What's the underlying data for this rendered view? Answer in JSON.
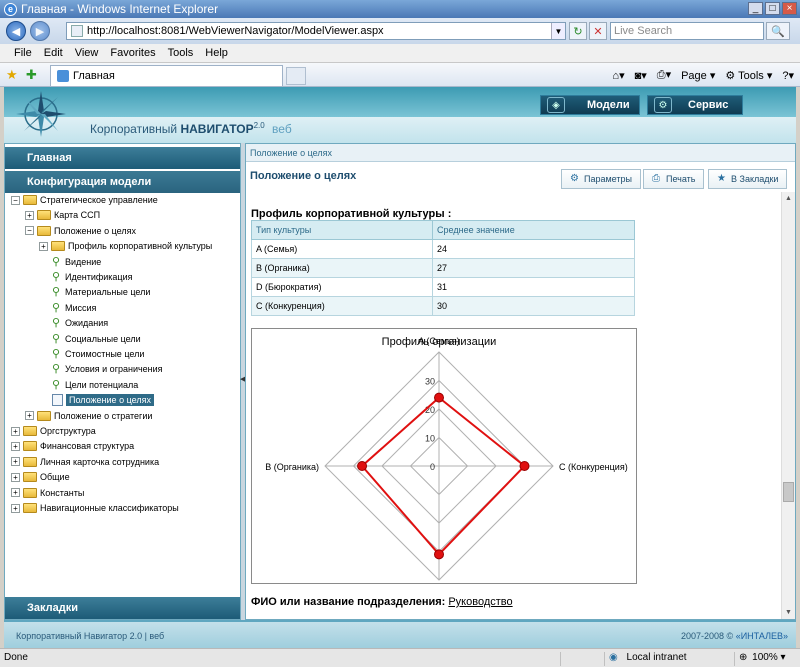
{
  "window": {
    "title": "Главная - Windows Internet Explorer"
  },
  "browser": {
    "address": "http://localhost:8081/WebViewerNavigator/ModelViewer.aspx",
    "search_placeholder": "Live Search",
    "menu": [
      "File",
      "Edit",
      "View",
      "Favorites",
      "Tools",
      "Help"
    ],
    "tab_title": "Главная",
    "commands": {
      "page": "Page",
      "tools": "Tools"
    }
  },
  "header": {
    "brand_name": "Корпоративный",
    "brand_bold": "НАВИГАТОР",
    "brand_version": "2.0",
    "brand_web": "веб",
    "buttons": [
      {
        "label": "Модели"
      },
      {
        "label": "Сервис"
      }
    ]
  },
  "left_panel": {
    "home": "Главная",
    "config": "Конфигурация модели",
    "bookmarks": "Закладки",
    "tree": [
      {
        "label": "Стратегическое управление",
        "level": 0,
        "type": "folder",
        "expander": "−"
      },
      {
        "label": "Карта ССП",
        "level": 1,
        "type": "folder",
        "expander": "+"
      },
      {
        "label": "Положение о целях",
        "level": 1,
        "type": "folder",
        "expander": "−"
      },
      {
        "label": "Профиль корпоративной культуры",
        "level": 2,
        "type": "folder",
        "expander": "+"
      },
      {
        "label": "Видение",
        "level": 2,
        "type": "leaf"
      },
      {
        "label": "Идентификация",
        "level": 2,
        "type": "leaf"
      },
      {
        "label": "Материальные цели",
        "level": 2,
        "type": "leaf"
      },
      {
        "label": "Миссия",
        "level": 2,
        "type": "leaf"
      },
      {
        "label": "Ожидания",
        "level": 2,
        "type": "leaf"
      },
      {
        "label": "Социальные цели",
        "level": 2,
        "type": "leaf"
      },
      {
        "label": "Стоимостные цели",
        "level": 2,
        "type": "leaf"
      },
      {
        "label": "Условия и ограничения",
        "level": 2,
        "type": "leaf"
      },
      {
        "label": "Цели потенциала",
        "level": 2,
        "type": "leaf"
      },
      {
        "label": "Положение о целях",
        "level": 2,
        "type": "page",
        "selected": true
      },
      {
        "label": "Положение о стратегии",
        "level": 1,
        "type": "folder",
        "expander": "+"
      },
      {
        "label": "Оргструктура",
        "level": 0,
        "type": "folder",
        "expander": "+"
      },
      {
        "label": "Финансовая структура",
        "level": 0,
        "type": "folder",
        "expander": "+"
      },
      {
        "label": "Личная карточка сотрудника",
        "level": 0,
        "type": "folder",
        "expander": "+"
      },
      {
        "label": "Общие",
        "level": 0,
        "type": "folder",
        "expander": "+"
      },
      {
        "label": "Константы",
        "level": 0,
        "type": "folder",
        "expander": "+"
      },
      {
        "label": "Навигационные классификаторы",
        "level": 0,
        "type": "folder",
        "expander": "+"
      }
    ]
  },
  "main": {
    "breadcrumb": "Положение о целях",
    "title": "Положение о целях",
    "toolbar": [
      {
        "label": "Параметры",
        "icon": "gear-icon"
      },
      {
        "label": "Печать",
        "icon": "printer-icon"
      },
      {
        "label": "В Закладки",
        "icon": "star-icon"
      }
    ],
    "section_title": "Профиль корпоративной культуры :",
    "table": {
      "headers": [
        "Тип культуры",
        "Среднее значение"
      ],
      "rows": [
        [
          "A (Семья)",
          "24"
        ],
        [
          "B (Органика)",
          "27"
        ],
        [
          "D (Бюрократия)",
          "31"
        ],
        [
          "C (Конкуренция)",
          "30"
        ]
      ]
    },
    "fio_label": "ФИО или название подразделения:",
    "fio_value": "Руководство"
  },
  "chart_data": {
    "type": "radar",
    "title": "Профиль организации",
    "categories": [
      "A (Семья)",
      "C (Конкуренция)",
      "D (Бюрократия)",
      "B (Органика)"
    ],
    "series": [
      {
        "values": [
          24,
          30,
          31,
          27
        ],
        "color": "#e01010"
      }
    ],
    "ticks": [
      0,
      10,
      20,
      30
    ],
    "max": 40
  },
  "footer": {
    "left": "Корпоративный Навигатор 2.0 | веб",
    "right_prefix": "2007-2008 © ",
    "right_link": "«ИНТАЛЕВ»"
  },
  "statusbar": {
    "left": "Done",
    "zone": "Local intranet",
    "zoom": "100%"
  }
}
